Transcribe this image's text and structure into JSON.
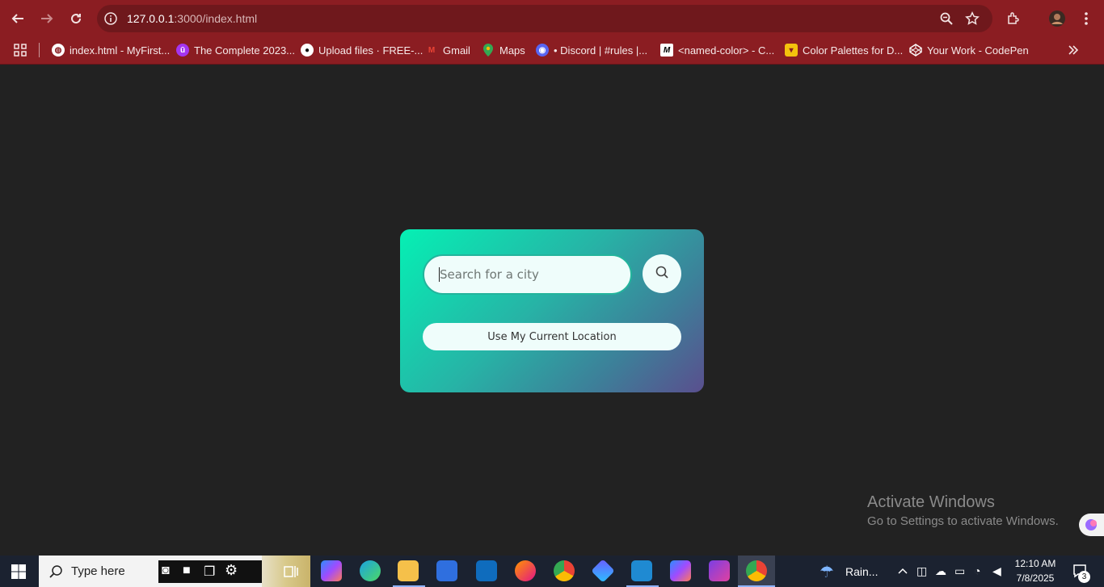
{
  "browser": {
    "url_host": "127.0.0.1",
    "url_path": ":3000/index.html",
    "bookmarks": [
      {
        "label": "index.html - MyFirst...",
        "icon": "globe-icon",
        "color": "#ffffff"
      },
      {
        "label": "The Complete 2023...",
        "icon": "udemy-icon",
        "color": "#a435f0"
      },
      {
        "label": "Upload files · FREE-...",
        "icon": "github-icon",
        "color": "#ffffff"
      },
      {
        "label": "Gmail",
        "icon": "gmail-icon",
        "color": "#ea4335"
      },
      {
        "label": "Maps",
        "icon": "maps-icon",
        "color": "#34a853"
      },
      {
        "label": "• Discord | #rules |...",
        "icon": "discord-icon",
        "color": "#5865f2"
      },
      {
        "label": "<named-color> - C...",
        "icon": "mdn-icon",
        "color": "#000000"
      },
      {
        "label": "Color Palettes for D...",
        "icon": "palette-icon",
        "color": "#f4c20d"
      },
      {
        "label": "Your Work - CodePen",
        "icon": "codepen-icon",
        "color": "#ffffff"
      }
    ]
  },
  "app": {
    "search_placeholder": "Search for a city",
    "location_button": "Use My Current Location"
  },
  "watermark": {
    "title": "Activate Windows",
    "subtitle": "Go to Settings to activate Windows."
  },
  "taskbar": {
    "search_text": "Type here",
    "weather": "Rain...",
    "time": "12:10 AM",
    "date": "7/8/2025",
    "notifications": "3"
  }
}
